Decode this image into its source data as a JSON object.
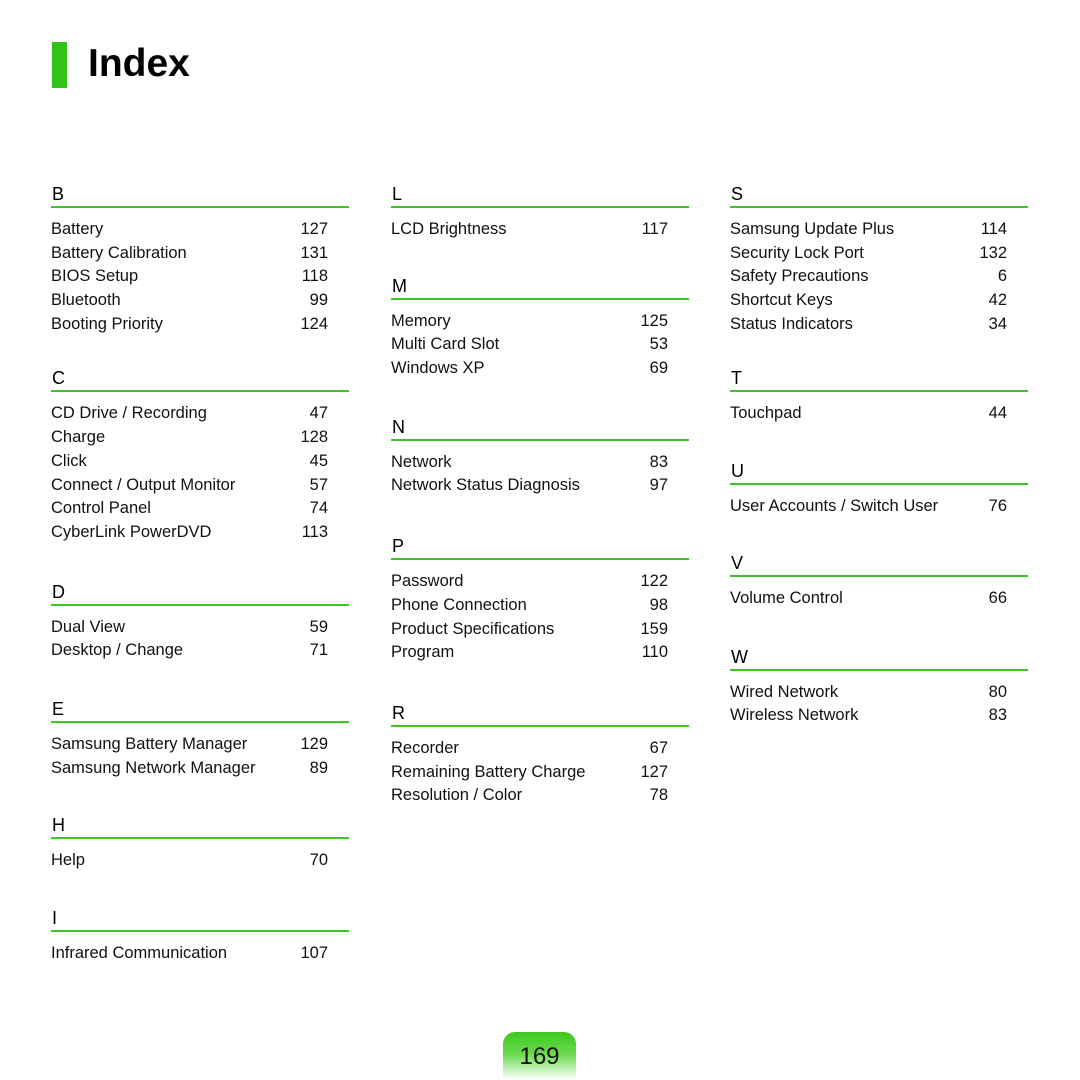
{
  "page": {
    "title": "Index",
    "page_number": "169",
    "accent_color": "#3cc524"
  },
  "columns": [
    {
      "sections": [
        {
          "letter": "B",
          "entries": [
            {
              "term": "Battery",
              "page": "127"
            },
            {
              "term": "Battery Calibration",
              "page": "131"
            },
            {
              "term": "BIOS Setup",
              "page": "118"
            },
            {
              "term": "Bluetooth",
              "page": "99"
            },
            {
              "term": "Booting Priority",
              "page": "124"
            }
          ]
        },
        {
          "letter": "C",
          "entries": [
            {
              "term": "CD Drive / Recording",
              "page": "47"
            },
            {
              "term": "Charge",
              "page": "128"
            },
            {
              "term": "Click",
              "page": "45"
            },
            {
              "term": "Connect / Output Monitor",
              "page": "57"
            },
            {
              "term": "Control Panel",
              "page": "74"
            },
            {
              "term": "CyberLink PowerDVD",
              "page": "113"
            }
          ]
        },
        {
          "letter": "D",
          "entries": [
            {
              "term": "Dual View",
              "page": "59"
            },
            {
              "term": "Desktop / Change",
              "page": "71"
            }
          ]
        },
        {
          "letter": "E",
          "entries": [
            {
              "term": "Samsung Battery Manager",
              "page": "129"
            },
            {
              "term": "Samsung Network Manager",
              "page": "89"
            }
          ]
        },
        {
          "letter": "H",
          "entries": [
            {
              "term": "Help",
              "page": "70"
            }
          ]
        },
        {
          "letter": "I",
          "entries": [
            {
              "term": "Infrared Communication",
              "page": "107"
            }
          ]
        }
      ]
    },
    {
      "sections": [
        {
          "letter": "L",
          "entries": [
            {
              "term": "LCD Brightness",
              "page": "117"
            }
          ]
        },
        {
          "letter": "M",
          "entries": [
            {
              "term": "Memory",
              "page": "125"
            },
            {
              "term": "Multi Card Slot",
              "page": "53"
            },
            {
              "term": "Windows XP",
              "page": "69"
            }
          ]
        },
        {
          "letter": "N",
          "entries": [
            {
              "term": "Network",
              "page": "83"
            },
            {
              "term": "Network Status Diagnosis",
              "page": "97"
            }
          ]
        },
        {
          "letter": "P",
          "entries": [
            {
              "term": "Password",
              "page": "122"
            },
            {
              "term": "Phone Connection",
              "page": "98"
            },
            {
              "term": "Product Specifications",
              "page": "159"
            },
            {
              "term": "Program",
              "page": "110"
            }
          ]
        },
        {
          "letter": "R",
          "entries": [
            {
              "term": "Recorder",
              "page": "67"
            },
            {
              "term": "Remaining Battery Charge",
              "page": "127"
            },
            {
              "term": "Resolution / Color",
              "page": "78"
            }
          ]
        }
      ]
    },
    {
      "sections": [
        {
          "letter": "S",
          "entries": [
            {
              "term": "Samsung Update Plus",
              "page": "114"
            },
            {
              "term": "Security Lock Port",
              "page": "132"
            },
            {
              "term": "Safety Precautions",
              "page": "6"
            },
            {
              "term": "Shortcut Keys",
              "page": "42"
            },
            {
              "term": "Status Indicators",
              "page": "34"
            }
          ]
        },
        {
          "letter": "T",
          "entries": [
            {
              "term": "Touchpad",
              "page": "44"
            }
          ]
        },
        {
          "letter": "U",
          "entries": [
            {
              "term": "User Accounts / Switch User",
              "page": "76"
            }
          ]
        },
        {
          "letter": "V",
          "entries": [
            {
              "term": "Volume Control",
              "page": "66"
            }
          ]
        },
        {
          "letter": "W",
          "entries": [
            {
              "term": "Wired Network",
              "page": "80"
            },
            {
              "term": "Wireless Network",
              "page": "83"
            }
          ]
        }
      ]
    }
  ]
}
